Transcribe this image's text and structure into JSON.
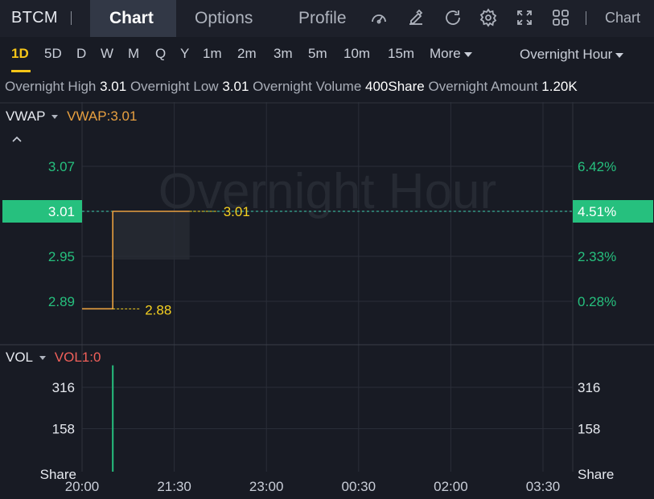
{
  "header": {
    "ticker": "BTCM",
    "tabs": [
      {
        "label": "Chart",
        "active": true
      },
      {
        "label": "Options",
        "active": false
      },
      {
        "label": "Profile",
        "active": false
      }
    ],
    "icons": [
      "gauge-icon",
      "draw-icon",
      "refresh-icon",
      "settings-icon",
      "fullscreen-icon",
      "layout-grid-icon"
    ],
    "right_label": "Chart"
  },
  "periods": {
    "items": [
      "1D",
      "5D",
      "D",
      "W",
      "M",
      "Q",
      "Y",
      "1m",
      "2m",
      "3m",
      "5m",
      "10m",
      "15m"
    ],
    "active": "1D",
    "more_label": "More",
    "session_label": "Overnight Hour"
  },
  "stats": {
    "high_label": "Overnight High",
    "high_value": "3.01",
    "low_label": "Overnight Low",
    "low_value": "3.01",
    "volume_label": "Overnight Volume",
    "volume_value": "400Share",
    "amount_label": "Overnight Amount",
    "amount_value": "1.20K"
  },
  "colors": {
    "background": "#181b24",
    "up_green": "#26c07e",
    "price_line": "#e8a040",
    "annotation_yellow": "#f5d020",
    "vol_title_red": "#f0605a",
    "accent_yellow": "#f5c518"
  },
  "chart_data": [
    {
      "type": "line",
      "panel": "price",
      "title": "VWAP",
      "indicator_label": "VWAP:3.01",
      "watermark": "Overnight Hour",
      "x_ticks": [
        "20:00",
        "21:30",
        "23:00",
        "00:30",
        "02:00",
        "03:30"
      ],
      "y_ticks": [
        3.07,
        3.01,
        2.95,
        2.89
      ],
      "y_tick_labels": [
        "3.07",
        "3.01",
        "2.95",
        "2.89"
      ],
      "right_ticks": [
        "6.42%",
        "4.51%",
        "2.33%",
        "0.28%"
      ],
      "series": [
        {
          "x": [
            "20:00",
            "20:30",
            "20:30",
            "21:45"
          ],
          "values": [
            2.88,
            2.88,
            3.01,
            3.01
          ]
        }
      ],
      "current_price": "3.01",
      "current_change": "4.51%",
      "annotations": [
        {
          "label": "3.01",
          "x": "21:45",
          "value": 3.01
        },
        {
          "label": "2.88",
          "x": "20:30",
          "value": 2.88
        }
      ],
      "grid": true
    },
    {
      "type": "bar",
      "panel": "volume",
      "title": "VOL",
      "indicator_label": "VOL1:0",
      "y_ticks": [
        316,
        158
      ],
      "y_tick_labels": [
        "316",
        "158"
      ],
      "unit": "Share",
      "bars": [
        {
          "x": "20:30",
          "value": 400
        }
      ],
      "grid": true
    }
  ]
}
